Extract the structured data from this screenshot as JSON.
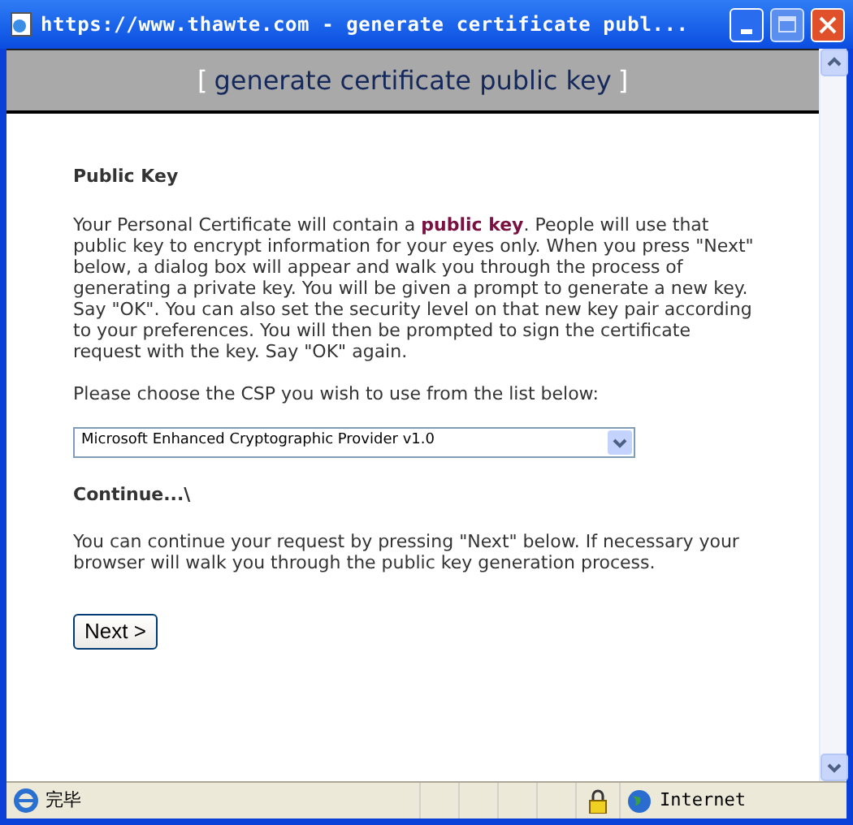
{
  "window": {
    "title": "https://www.thawte.com - generate certificate publ..."
  },
  "header": {
    "open_bracket": "[",
    "title": "generate certificate public key",
    "close_bracket": "]"
  },
  "sections": [
    {
      "heading": "Public Key",
      "paragraphs": [
        "Your Personal Certificate will contain a **public key**. People will use that public key to encrypt information for your eyes only. When you press \"Next\" below, a dialog box will appear and walk you through the process of generating a private key. You will be given a prompt to generate a new key. Say \"OK\". You can also set the security level on that new key pair according to your preferences. You will then be prompted to sign the certificate request with the key. Say \"OK\" again.",
        "Please choose the CSP you wish to use from the list below:"
      ]
    },
    {
      "heading": "Continue...\\",
      "paragraphs": [
        "You can continue your request by pressing \"Next\" below. If necessary your browser will walk you through the public key generation process."
      ]
    }
  ],
  "csp_select": {
    "value": "Microsoft Enhanced Cryptographic Provider v1.0"
  },
  "next_button": "Next >",
  "status_bar": {
    "text": "完毕",
    "zone": "Internet"
  }
}
